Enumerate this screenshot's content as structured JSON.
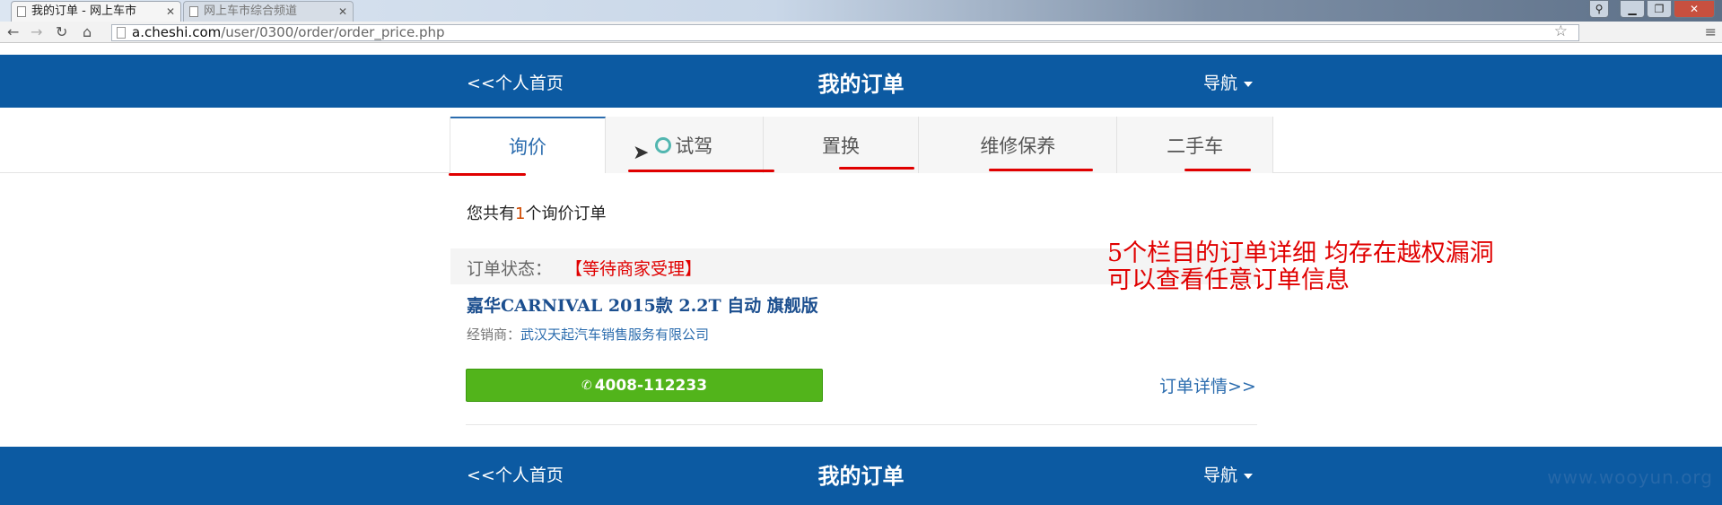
{
  "browser": {
    "active_tab_title": "我的订单 - 网上车市",
    "inactive_tab_title": "网上车市综合频道",
    "url_domain": "a.cheshi.com",
    "url_path": "/user/0300/order/order_price.php"
  },
  "header": {
    "back_label": "<<个人首页",
    "title": "我的订单",
    "nav_label": "导航"
  },
  "tabs": [
    {
      "label": "询价",
      "active": true
    },
    {
      "label": "试驾",
      "active": false,
      "loading": true
    },
    {
      "label": "置换",
      "active": false
    },
    {
      "label": "维修保养",
      "active": false
    },
    {
      "label": "二手车",
      "active": false
    }
  ],
  "order_summary": {
    "prefix": "您共有",
    "count": "1",
    "suffix": "个询价订单"
  },
  "order": {
    "status_label": "订单状态：",
    "status_value": "【等待商家受理】",
    "car_model": "嘉华CARNIVAL 2015款 2.2T 自动 旗舰版",
    "dealer_label": "经销商：",
    "dealer_name": "武汉天起汽车销售服务有限公司",
    "phone": "4008-112233",
    "detail_link": "订单详情>>"
  },
  "annotation": {
    "line1": "5个栏目的订单详细 均存在越权漏洞",
    "line2": "可以查看任意订单信息",
    "color": "#e00000"
  },
  "footer_header": {
    "back_label": "<<个人首页",
    "title": "我的订单",
    "nav_label": "导航"
  },
  "watermark": "www.wooyun.org",
  "colors": {
    "brand_blue": "#0c5aa2",
    "call_green": "#52b41b",
    "link_blue": "#2b6cae"
  }
}
